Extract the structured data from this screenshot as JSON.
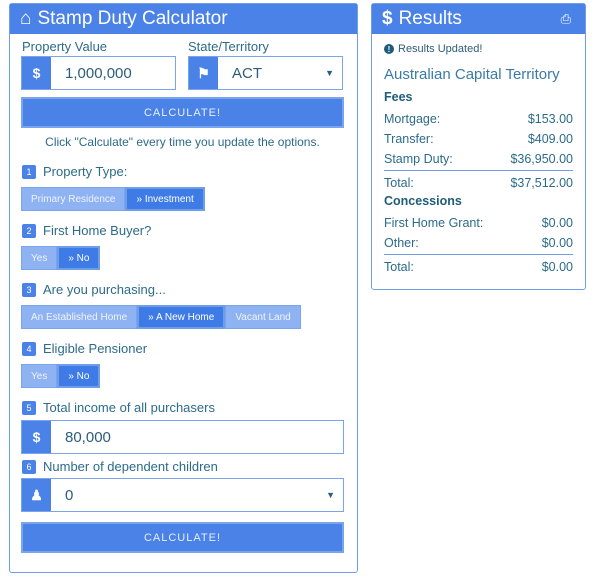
{
  "calculator": {
    "title": "Stamp Duty Calculator",
    "property_value_label": "Property Value",
    "property_value": "1,000,000",
    "state_label": "State/Territory",
    "state_value": "ACT",
    "calculate_label": "CALCULATE!",
    "hint": "Click \"Calculate\" every time you update the options.",
    "steps": [
      {
        "num": "1",
        "label": "Property Type:",
        "options": [
          "Primary Residence",
          "» Investment"
        ],
        "selected": 1
      },
      {
        "num": "2",
        "label": "First Home Buyer?",
        "options": [
          "Yes",
          "» No"
        ],
        "selected": 1
      },
      {
        "num": "3",
        "label": "Are you purchasing...",
        "options": [
          "An Established Home",
          "» A New Home",
          "Vacant Land"
        ],
        "selected": 1
      },
      {
        "num": "4",
        "label": "Eligible Pensioner",
        "options": [
          "Yes",
          "» No"
        ],
        "selected": 1
      },
      {
        "num": "5",
        "label": "Total income of all purchasers",
        "value": "80,000"
      },
      {
        "num": "6",
        "label": "Number of dependent children",
        "value": "0"
      }
    ],
    "currency_symbol": "$"
  },
  "results": {
    "title": "Results",
    "status": "Results Updated!",
    "region": "Australian Capital Territory",
    "fees_heading": "Fees",
    "fees": [
      {
        "label": "Mortgage:",
        "value": "$153.00"
      },
      {
        "label": "Transfer:",
        "value": "$409.00"
      },
      {
        "label": "Stamp Duty:",
        "value": "$36,950.00"
      }
    ],
    "fees_total": {
      "label": "Total:",
      "value": "$37,512.00"
    },
    "concessions_heading": "Concessions",
    "concessions": [
      {
        "label": "First Home Grant:",
        "value": "$0.00"
      },
      {
        "label": "Other:",
        "value": "$0.00"
      }
    ],
    "concessions_total": {
      "label": "Total:",
      "value": "$0.00"
    }
  },
  "colors": {
    "primary": "#4a82e8",
    "inactive": "#8fb3f2",
    "text": "#2c6b8a"
  }
}
